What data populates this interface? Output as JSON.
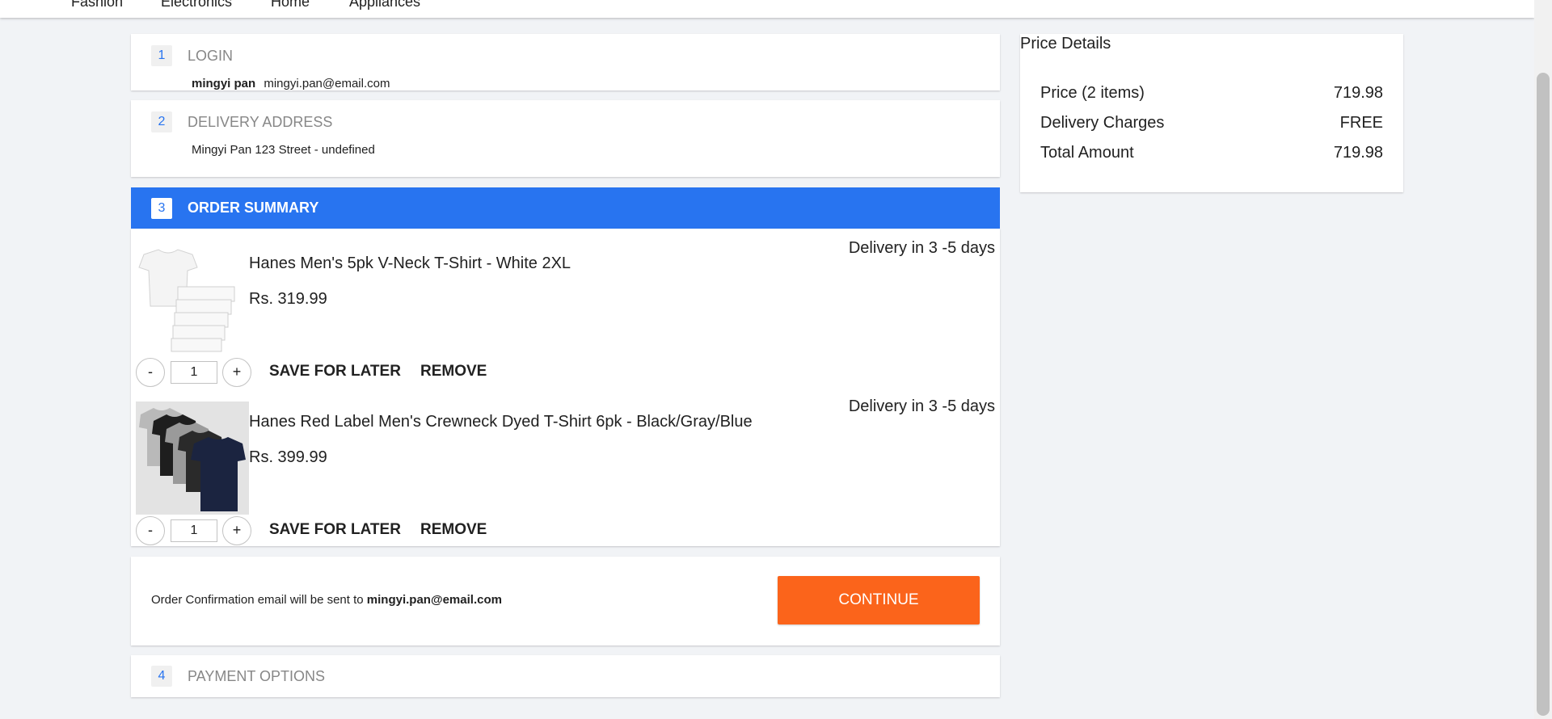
{
  "nav": {
    "links": [
      "Fashion",
      "Electronics",
      "Home",
      "Appliances"
    ]
  },
  "steps": {
    "login": {
      "number": "1",
      "title": "LOGIN",
      "user_name": "mingyi pan",
      "user_email": "mingyi.pan@email.com"
    },
    "delivery": {
      "number": "2",
      "title": "DELIVERY ADDRESS",
      "address": "Mingyi Pan 123 Street - undefined"
    },
    "summary": {
      "number": "3",
      "title": "ORDER SUMMARY"
    },
    "payment": {
      "number": "4",
      "title": "PAYMENT OPTIONS"
    }
  },
  "items": [
    {
      "name": "Hanes Men's 5pk V-Neck T-Shirt - White 2XL",
      "price": "Rs. 319.99",
      "delivery": "Delivery in 3 -5 days",
      "quantity": "1",
      "image_icon": "white-tshirt-stack-image"
    },
    {
      "name": "Hanes Red Label Men's Crewneck Dyed T-Shirt 6pk - Black/Gray/Blue",
      "price": "Rs. 399.99",
      "delivery": "Delivery in 3 -5 days",
      "quantity": "1",
      "image_icon": "colored-tshirt-stack-image"
    }
  ],
  "actions": {
    "minus": "-",
    "plus": "+",
    "save_for_later": "SAVE FOR LATER",
    "remove": "REMOVE"
  },
  "confirmation": {
    "prefix": "Order Confirmation email will be sent to ",
    "email": "mingyi.pan@email.com",
    "continue": "CONTINUE"
  },
  "price_details": {
    "title": "Price Details",
    "rows": [
      {
        "label": "Price (2 items)",
        "value": "719.98"
      },
      {
        "label": "Delivery Charges",
        "value": "FREE"
      },
      {
        "label": "Total Amount",
        "value": "719.98"
      }
    ]
  },
  "colors": {
    "primary": "#2874f0",
    "accent": "#fb641b",
    "background": "#f1f3f6"
  }
}
